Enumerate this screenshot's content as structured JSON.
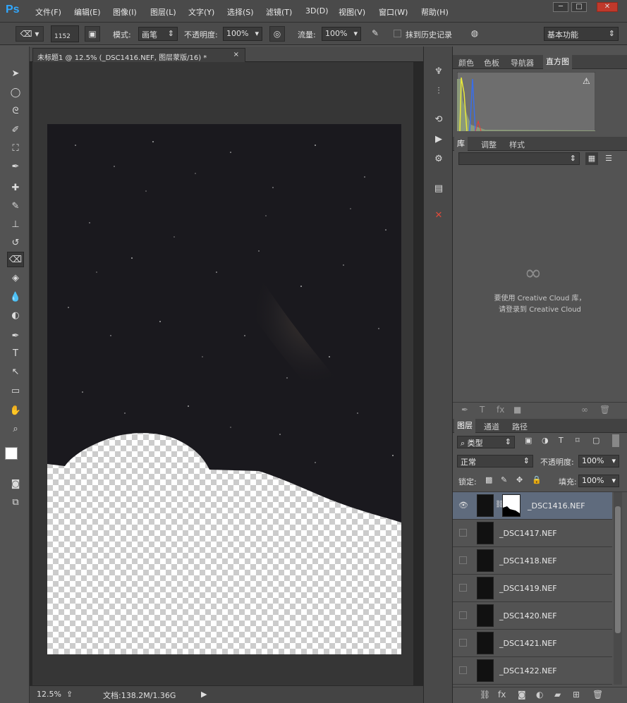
{
  "app": {
    "logo": "Ps"
  },
  "menu": [
    "文件(F)",
    "编辑(E)",
    "图像(I)",
    "图层(L)",
    "文字(Y)",
    "选择(S)",
    "滤镜(T)",
    "3D(D)",
    "视图(V)",
    "窗口(W)",
    "帮助(H)"
  ],
  "window_controls": {
    "minimize": "─",
    "maximize": "□",
    "close": "✕"
  },
  "options": {
    "brush_size": "1152",
    "mode_label": "模式:",
    "mode_value": "画笔",
    "opacity_label": "不透明度:",
    "opacity_value": "100%",
    "flow_label": "流量:",
    "flow_value": "100%",
    "history_label": "抹到历史记录",
    "workspace": "基本功能"
  },
  "document": {
    "tab_title": "未标题1 @ 12.5% (_DSC1416.NEF, 图层蒙版/16) *",
    "tab_close": "×",
    "zoom": "12.5%",
    "doc_size": "文档:138.2M/1.36G"
  },
  "panels": {
    "top_tabs": [
      "颜色",
      "色板",
      "导航器",
      "直方图"
    ],
    "top_active": "直方图",
    "lib_tabs": [
      "库",
      "调整",
      "样式"
    ],
    "cc_message_line1": "要使用 Creative Cloud 库，",
    "cc_message_line2": "请登录到 Creative Cloud",
    "layer_tabs": [
      "图层",
      "通道",
      "路径"
    ],
    "filter_kind": "类型",
    "blend_mode": "正常",
    "opacity_label": "不透明度:",
    "opacity_value": "100%",
    "lock_label": "锁定:",
    "fill_label": "填充:",
    "fill_value": "100%"
  },
  "layers": [
    {
      "name": "_DSC1416.NEF",
      "visible": true,
      "selected": true,
      "has_mask": true
    },
    {
      "name": "_DSC1417.NEF",
      "visible": false,
      "selected": false,
      "has_mask": false
    },
    {
      "name": "_DSC1418.NEF",
      "visible": false,
      "selected": false,
      "has_mask": false
    },
    {
      "name": "_DSC1419.NEF",
      "visible": false,
      "selected": false,
      "has_mask": false
    },
    {
      "name": "_DSC1420.NEF",
      "visible": false,
      "selected": false,
      "has_mask": false
    },
    {
      "name": "_DSC1421.NEF",
      "visible": false,
      "selected": false,
      "has_mask": false
    },
    {
      "name": "_DSC1422.NEF",
      "visible": false,
      "selected": false,
      "has_mask": false
    }
  ],
  "colors": {
    "accent": "#31a8ff",
    "selected_layer": "#5f6b7d",
    "panel_bg": "#535353"
  }
}
